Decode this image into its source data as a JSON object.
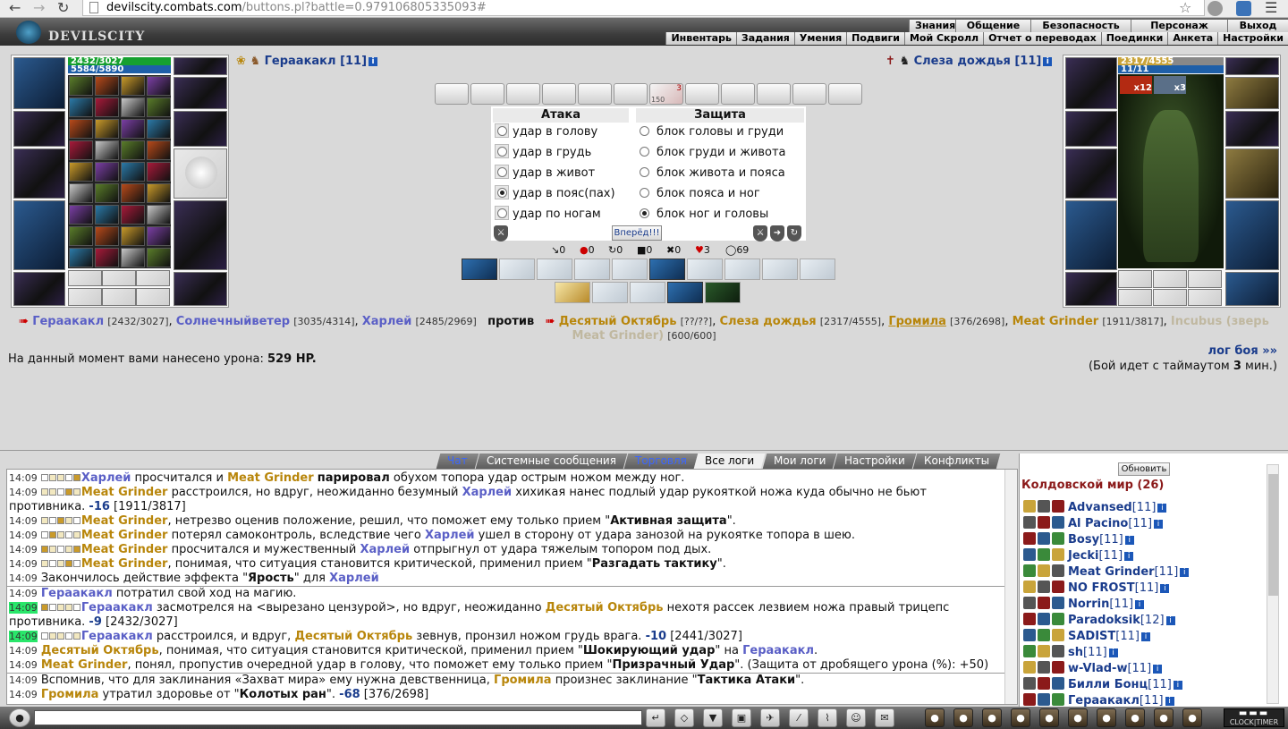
{
  "browser": {
    "url_host": "devilscity.combats.com",
    "url_path": "/buttons.pl?battle=0.979106805335093#"
  },
  "site": {
    "logo_text": "DEVILSCITY"
  },
  "top_menu": [
    "Знания",
    "Общение",
    "Безопасность",
    "Персонаж",
    "Выход"
  ],
  "sub_menu": [
    "Инвентарь",
    "Задания",
    "Умения",
    "Подвиги",
    "Мой Скролл",
    "Отчет о переводах",
    "Поединки",
    "Анкета",
    "Настройки"
  ],
  "player": {
    "name": "Гераакакл",
    "level": "[11]",
    "hp": "2432/3027",
    "mana": "5584/5890",
    "hp_frac": 0.8,
    "mana_frac": 0.95
  },
  "enemy": {
    "name": "Слеза дождья",
    "level": "[11]",
    "hp": "2317/4555",
    "mana": "11/11",
    "hp_frac": 0.51,
    "mana_frac": 1.0,
    "buff1": "x12",
    "buff2": "x3"
  },
  "center": {
    "scroll_badge": "3",
    "scroll_sub": "150"
  },
  "attack": {
    "title": "Атака",
    "options": [
      "удар в голову",
      "удар в грудь",
      "удар в живот",
      "удар в пояс(пах)",
      "удар по ногам"
    ],
    "selected": 3
  },
  "defense": {
    "title": "Защита",
    "options": [
      "блок головы и груди",
      "блок груди и живота",
      "блок живота и пояса",
      "блок пояса и ног",
      "блок ног и головы"
    ],
    "selected": 4
  },
  "go_button": "Вперёд!!!",
  "stats": [
    "0",
    "0",
    "0",
    "0",
    "0",
    "3",
    "69"
  ],
  "fighters": {
    "side_a": [
      {
        "name": "Гераакакл",
        "hp": "[2432/3027]"
      },
      {
        "name": "Солнечныйветер",
        "hp": "[3035/4314]"
      },
      {
        "name": "Харлей",
        "hp": "[2485/2969]"
      }
    ],
    "versus": "против",
    "side_b": [
      {
        "name": "Десятый Октябрь",
        "hp": "[??/??]"
      },
      {
        "name": "Слеза дождья",
        "hp": "[2317/4555]"
      },
      {
        "name": "Громила",
        "hp": "[376/2698]"
      },
      {
        "name": "Meat Grinder",
        "hp": "[1911/3817]"
      },
      {
        "name": "Incubus (зверь Meat Grinder)",
        "hp": "[600/600]"
      }
    ]
  },
  "damage": {
    "label": "На данный момент вами нанесено урона:",
    "value": "529 HP."
  },
  "log_link": "лог боя »»",
  "timeout": {
    "pre": "(Бой идет с таймаутом",
    "value": "3",
    "post": "мин.)"
  },
  "tabs": [
    "Чат",
    "Системные сообщения",
    "Торговля",
    "Все логи",
    "Мои логи",
    "Настройки",
    "Конфликты"
  ],
  "chat": [
    {
      "t": "14:09",
      "parts": [
        [
          "b",
          "Харлей"
        ],
        [
          " просчитался и "
        ],
        [
          "g",
          "Meat Grinder"
        ],
        [
          " "
        ],
        [
          "k",
          "парировал"
        ],
        [
          " обухом топора удар острым ножом между ног."
        ]
      ]
    },
    {
      "t": "14:09",
      "parts": [
        [
          "g",
          "Meat Grinder"
        ],
        [
          " расстроился, но вдруг, неожиданно безумный "
        ],
        [
          "b",
          "Харлей"
        ],
        [
          " хихикая нанес подлый удар рукояткой ножа куда обычно не бьют противника. "
        ],
        [
          "n",
          "-16"
        ],
        [
          " [1911/3817]"
        ]
      ]
    },
    {
      "t": "14:09",
      "parts": [
        [
          "g",
          "Meat Grinder"
        ],
        [
          ", нетрезво оценив положение, решил, что поможет ему только прием \""
        ],
        [
          "k",
          "Активная защита"
        ],
        [
          "\"."
        ]
      ]
    },
    {
      "t": "14:09",
      "parts": [
        [
          "g",
          "Meat Grinder"
        ],
        [
          " потерял самоконтроль, вследствие чего "
        ],
        [
          "b",
          "Харлей"
        ],
        [
          " ушел в сторону от удара занозой на рукоятке топора в шею."
        ]
      ]
    },
    {
      "t": "14:09",
      "parts": [
        [
          "g",
          "Meat Grinder"
        ],
        [
          " просчитался и мужественный "
        ],
        [
          "b",
          "Харлей"
        ],
        [
          " отпрыгнул от удара тяжелым топором под дых."
        ]
      ]
    },
    {
      "t": "14:09",
      "parts": [
        [
          "g",
          "Meat Grinder"
        ],
        [
          ", понимая, что ситуация становится критической, применил прием \""
        ],
        [
          "k",
          "Разгадать тактику"
        ],
        [
          "\"."
        ]
      ]
    },
    {
      "t": "14:09",
      "parts": [
        [
          "Закончилось действие эффекта \""
        ],
        [
          "k",
          "Ярость"
        ],
        [
          "\" для "
        ],
        [
          "b",
          "Харлей"
        ]
      ]
    },
    {
      "t": "14:09",
      "parts": [
        [
          "b",
          "Гераакакл"
        ],
        [
          " потратил свой ход на магию."
        ]
      ]
    },
    {
      "t": "14:09",
      "parts": [
        [
          "b",
          "Гераакакл"
        ],
        [
          " засмотрелся на <вырезано цензурой>, но вдруг, неожиданно "
        ],
        [
          "g",
          "Десятый Октябрь"
        ],
        [
          " нехотя рассек лезвием ножа правый трицепс противника. "
        ],
        [
          "n",
          "-9"
        ],
        [
          " [2432/3027]"
        ]
      ]
    },
    {
      "t": "14:09",
      "parts": [
        [
          "b",
          "Гераакакл"
        ],
        [
          " расстроился, и вдруг, "
        ],
        [
          "g",
          "Десятый Октябрь"
        ],
        [
          " зевнув, пронзил ножом грудь врага. "
        ],
        [
          "n",
          "-10"
        ],
        [
          " [2441/3027]"
        ]
      ]
    },
    {
      "t": "14:09",
      "parts": [
        [
          "g",
          "Десятый Октябрь"
        ],
        [
          ", понимая, что ситуация становится критической, применил прием \""
        ],
        [
          "k",
          "Шокирующий удар"
        ],
        [
          "\" на "
        ],
        [
          "b",
          "Гераакакл"
        ],
        [
          "."
        ]
      ]
    },
    {
      "t": "14:09",
      "parts": [
        [
          "g",
          "Meat Grinder"
        ],
        [
          ", понял, пропустив очередной удар в голову, что поможет ему только прием \""
        ],
        [
          "k",
          "Призрачный Удар"
        ],
        [
          "\". (Защита от дробящего урона (%): +50)"
        ]
      ]
    },
    {
      "t": "14:09",
      "parts": [
        [
          "Вспомнив, что для заклинания «Захват мира» ему нужна девственница, "
        ],
        [
          "g",
          "Громила"
        ],
        [
          " произнес заклинание \""
        ],
        [
          "k",
          "Тактика Атаки"
        ],
        [
          "\"."
        ]
      ]
    },
    {
      "t": "14:09",
      "parts": [
        [
          "g",
          "Громила"
        ],
        [
          " утратил здоровье от \""
        ],
        [
          "k",
          "Колотых ран"
        ],
        [
          "\". "
        ],
        [
          "n",
          "-68"
        ],
        [
          " [376/2698]"
        ]
      ]
    }
  ],
  "online": {
    "refresh": "Обновить",
    "room": "Колдовской мир (26)",
    "players": [
      {
        "name": "Advansed",
        "lv": "[11]"
      },
      {
        "name": "Al Pacino",
        "lv": "[11]"
      },
      {
        "name": "Bosy",
        "lv": "[11]"
      },
      {
        "name": "Jecki",
        "lv": "[11]"
      },
      {
        "name": "Meat Grinder",
        "lv": "[11]"
      },
      {
        "name": "NO FROST",
        "lv": "[11]"
      },
      {
        "name": "Norrin",
        "lv": "[11]"
      },
      {
        "name": "Paradoksik",
        "lv": "[12]"
      },
      {
        "name": "SADIST",
        "lv": "[11]"
      },
      {
        "name": "sh",
        "lv": "[11]"
      },
      {
        "name": "w-Vlad-w",
        "lv": "[11]"
      },
      {
        "name": "Билли Бонц",
        "lv": "[11]"
      },
      {
        "name": "Гераакакл",
        "lv": "[11]"
      }
    ]
  },
  "clock": {
    "top": "CLOCK",
    "bottom": "TIMER"
  }
}
